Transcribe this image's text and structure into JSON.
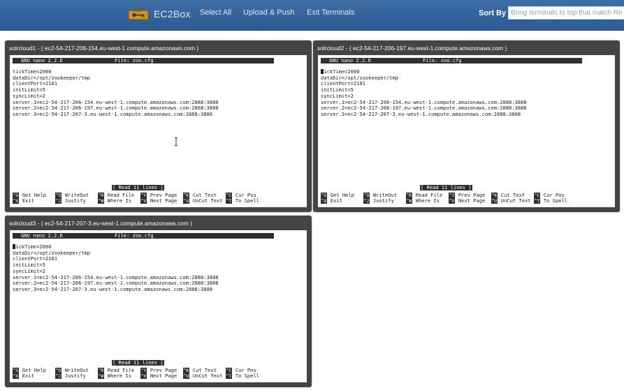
{
  "app": {
    "brand": "EC2Box",
    "nav": [
      "Select All",
      "Upload & Push",
      "Exit Terminals"
    ],
    "sort_label": "Sort By",
    "sort_placeholder": "Bring terminals to top that match Re"
  },
  "nano": {
    "version": "GNU nano 2.2.6",
    "file": "File: zoo.cfg",
    "status": "[ Read 11 lines ]",
    "lines": [
      "tickTime=2000",
      "dataDir=/opt/zookeeper/tmp",
      "clientPort=2181",
      "initLimit=5",
      "syncLimit=2",
      "server.1=ec2-54-217-206-154.eu-west-1.compute.amazonaws.com:2888:3888",
      "server.2=ec2-54-217-206-197.eu-west-1.compute.amazonaws.com:2888:3888",
      "server.3=ec2-54-217-207-3.eu-west-1.compute.amazonaws.com:2888:3888"
    ],
    "shortcuts_row1": [
      {
        "key": "^G",
        "label": "Get Help"
      },
      {
        "key": "^O",
        "label": "WriteOut"
      },
      {
        "key": "^R",
        "label": "Read File"
      },
      {
        "key": "^Y",
        "label": "Prev Page"
      },
      {
        "key": "^K",
        "label": "Cut Text"
      },
      {
        "key": "^C",
        "label": "Cur Pos"
      }
    ],
    "shortcuts_row2": [
      {
        "key": "^X",
        "label": "Exit"
      },
      {
        "key": "^J",
        "label": "Justify"
      },
      {
        "key": "^W",
        "label": "Where Is"
      },
      {
        "key": "^V",
        "label": "Next Page"
      },
      {
        "key": "^U",
        "label": "UnCut Text"
      },
      {
        "key": "^T",
        "label": "To Spell"
      }
    ]
  },
  "terminals": [
    {
      "title": "solrcloud1 - ( ec2-54-217-206-154.eu-west-1.compute.amazonaws.com )"
    },
    {
      "title": "solrcloud2 - ( ec2-54-217-206-197.eu-west-1.compute.amazonaws.com )"
    },
    {
      "title": "solrcloud3 - ( ec2-54-217-207-3.eu-west-1.compute.amazonaws.com )"
    }
  ],
  "colors": {
    "navbar": "#3566a0",
    "terminal_frame": "#444444",
    "nano_bar": "#2f2f2f"
  }
}
